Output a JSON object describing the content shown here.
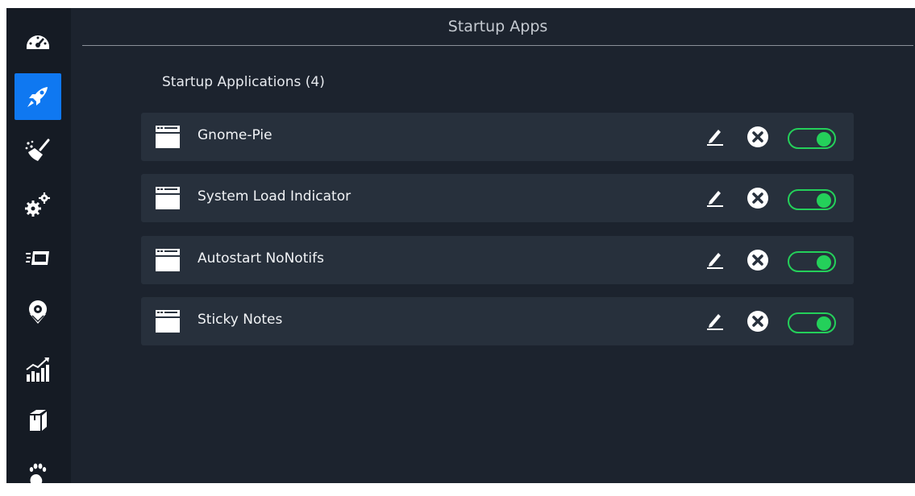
{
  "header": {
    "title": "Startup Apps"
  },
  "section": {
    "title": "Startup Applications (4)"
  },
  "sidebar": {
    "items": [
      {
        "icon": "dashboard-icon",
        "active": false
      },
      {
        "icon": "rocket-icon",
        "active": true
      },
      {
        "icon": "broom-icon",
        "active": false
      },
      {
        "icon": "gears-icon",
        "active": false
      },
      {
        "icon": "uninstaller-icon",
        "active": false
      },
      {
        "icon": "resources-icon",
        "active": false
      },
      {
        "icon": "stats-icon",
        "active": false
      },
      {
        "icon": "package-icon",
        "active": false
      },
      {
        "icon": "gnome-icon",
        "active": false
      }
    ]
  },
  "apps": [
    {
      "name": "Gnome-Pie",
      "enabled": true
    },
    {
      "name": "System Load Indicator",
      "enabled": true
    },
    {
      "name": "Autostart NoNotifs",
      "enabled": true
    },
    {
      "name": "Sticky Notes",
      "enabled": true
    }
  ],
  "colors": {
    "accent": "#0f78f1",
    "toggle_on": "#24d05a",
    "row_bg": "#27303c",
    "window_bg": "#1c232e",
    "sidebar_bg": "#151b24"
  }
}
